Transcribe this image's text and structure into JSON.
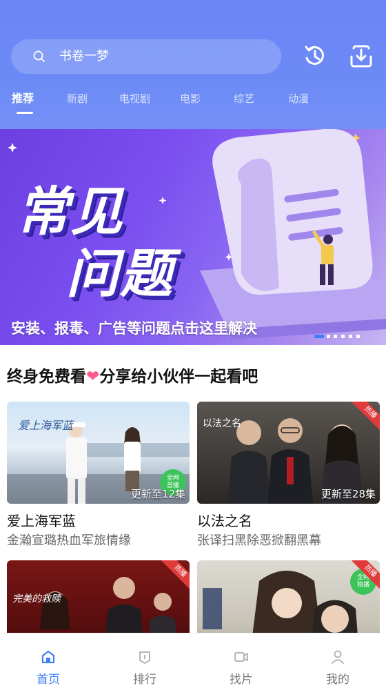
{
  "search": {
    "placeholder_text": "书卷一梦",
    "icon": "search-icon"
  },
  "header_buttons": {
    "history_icon": "history-icon",
    "download_icon": "download-icon"
  },
  "tabs": [
    {
      "label": "推荐",
      "active": true
    },
    {
      "label": "新剧",
      "active": false
    },
    {
      "label": "电视剧",
      "active": false
    },
    {
      "label": "电影",
      "active": false
    },
    {
      "label": "综艺",
      "active": false
    },
    {
      "label": "动漫",
      "active": false
    }
  ],
  "banner": {
    "headline_line1": "常见",
    "headline_line2": "问题",
    "caption": "安装、报毒、广告等问题点击这里解决",
    "slide_count": 6,
    "active_slide": 1
  },
  "section": {
    "title_before": "终身免费看",
    "heart": "❤",
    "title_after": "分享给小伙伴一起看吧"
  },
  "cards": [
    {
      "name": "爱上海军蓝",
      "desc": "金瀚宣璐热血军旅情缘",
      "episodes": "更新至12集",
      "badge": "全网首播"
    },
    {
      "name": "以法之名",
      "desc": "张译扫黑除恶掀翻黑幕",
      "episodes": "更新至28集",
      "badge": "热播"
    },
    {
      "name": "",
      "desc": "",
      "episodes": "",
      "badge": "热播"
    },
    {
      "name": "",
      "desc": "",
      "episodes": "",
      "badge": "热播"
    }
  ],
  "bottom_nav": [
    {
      "label": "首页",
      "icon": "home-icon",
      "active": true
    },
    {
      "label": "排行",
      "icon": "ranking-icon",
      "active": false
    },
    {
      "label": "找片",
      "icon": "video-icon",
      "active": false
    },
    {
      "label": "我的",
      "icon": "user-icon",
      "active": false
    }
  ],
  "colors": {
    "header": "#6c8af6",
    "accent": "#3f7ff5",
    "heart": "#ff5a8a"
  }
}
